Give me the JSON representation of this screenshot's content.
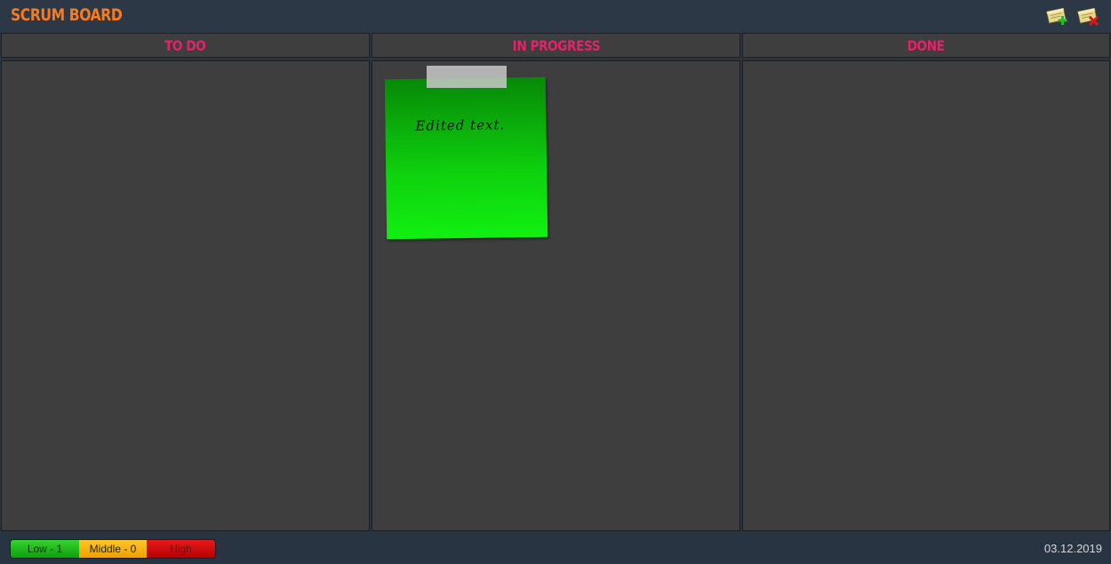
{
  "app": {
    "title": "SCRUM BOARD"
  },
  "toolbar": {
    "add_icon": "add-note-icon",
    "delete_icon": "delete-note-icon"
  },
  "columns": [
    {
      "title": "TO DO"
    },
    {
      "title": "IN PROGRESS"
    },
    {
      "title": "DONE"
    }
  ],
  "notes": [
    {
      "column": "IN PROGRESS",
      "text": "Edited text.",
      "priority": "Low",
      "color": "#0ed20e"
    }
  ],
  "legend": {
    "low": "Low - 1",
    "middle": "Middle - 0",
    "high": "High"
  },
  "status": {
    "date": "03.12.2019"
  },
  "colors": {
    "accent_title": "#ff7a1a",
    "column_title": "#e6206a",
    "low": "#1ec11e",
    "middle": "#f5b012",
    "high": "#d40c0c"
  }
}
